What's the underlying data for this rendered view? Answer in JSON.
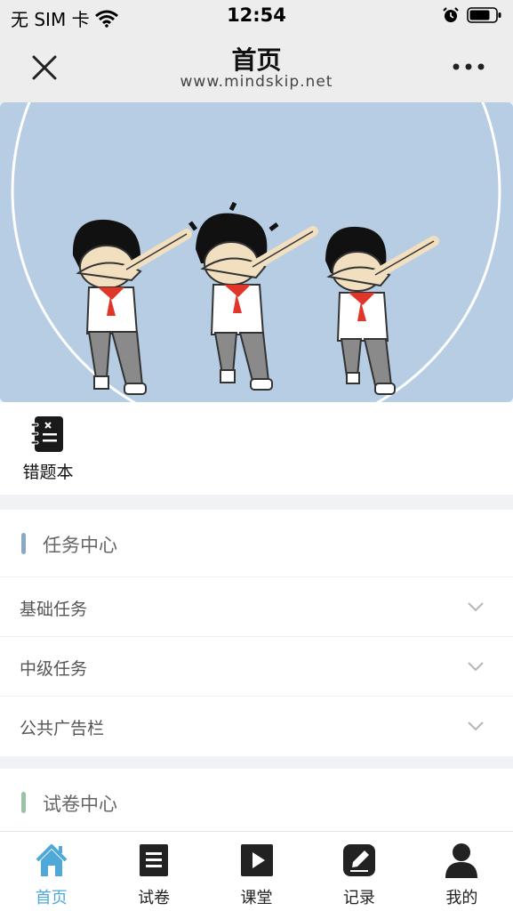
{
  "status_bar": {
    "carrier": "无 SIM 卡",
    "time": "12:54"
  },
  "nav": {
    "title": "首页",
    "url": "www.mindskip.net"
  },
  "quick_entry": {
    "label": "错题本"
  },
  "task_section": {
    "title": "任务中心",
    "rows": [
      {
        "label": "基础任务"
      },
      {
        "label": "中级任务"
      },
      {
        "label": "公共广告栏"
      }
    ]
  },
  "paper_section": {
    "title": "试卷中心"
  },
  "tabs": [
    {
      "label": "首页",
      "icon": "home-icon",
      "active": true
    },
    {
      "label": "试卷",
      "icon": "paper-icon",
      "active": false
    },
    {
      "label": "课堂",
      "icon": "play-icon",
      "active": false
    },
    {
      "label": "记录",
      "icon": "edit-icon",
      "active": false
    },
    {
      "label": "我的",
      "icon": "user-icon",
      "active": false
    }
  ],
  "colors": {
    "accent": "#4fa8d8",
    "banner_bg": "#b6cde3",
    "task_bar": "#8aa8c6",
    "paper_bar": "#9cc2a6"
  }
}
